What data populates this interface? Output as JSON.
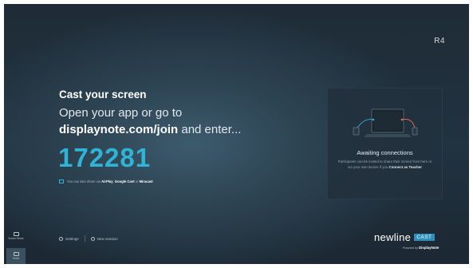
{
  "room_code": "R4",
  "cast": {
    "title": "Cast your screen",
    "line1": "Open your app or go to",
    "url": "displaynote.com/join",
    "line2_suffix": " and enter...",
    "code": "172281"
  },
  "protocols": {
    "prefix": "You can also share via ",
    "airplay": "AirPlay",
    "sep1": ", ",
    "google_cast": "Google Cast",
    "sep2": " or ",
    "miracast": "Miracast"
  },
  "panel": {
    "title": "Awaiting connections",
    "text_prefix": "Participants can be invited to share their screen from here or via your own device if you ",
    "text_link": "Connect as Teacher"
  },
  "sidebar": {
    "items": [
      {
        "label": "Screen Share",
        "icon": "screen-share-icon"
      },
      {
        "label": "Home",
        "icon": "home-icon"
      }
    ]
  },
  "footer": {
    "settings_label": "Settings",
    "new_session_label": "New session"
  },
  "brand": {
    "word": "newline",
    "badge": "CAST",
    "powered_prefix": "Powered by ",
    "powered_name": "DisplayNote"
  },
  "colors": {
    "accent": "#2fb4d6",
    "background": "#213240",
    "panel": "#22313d",
    "badge": "#2e8fbc"
  }
}
